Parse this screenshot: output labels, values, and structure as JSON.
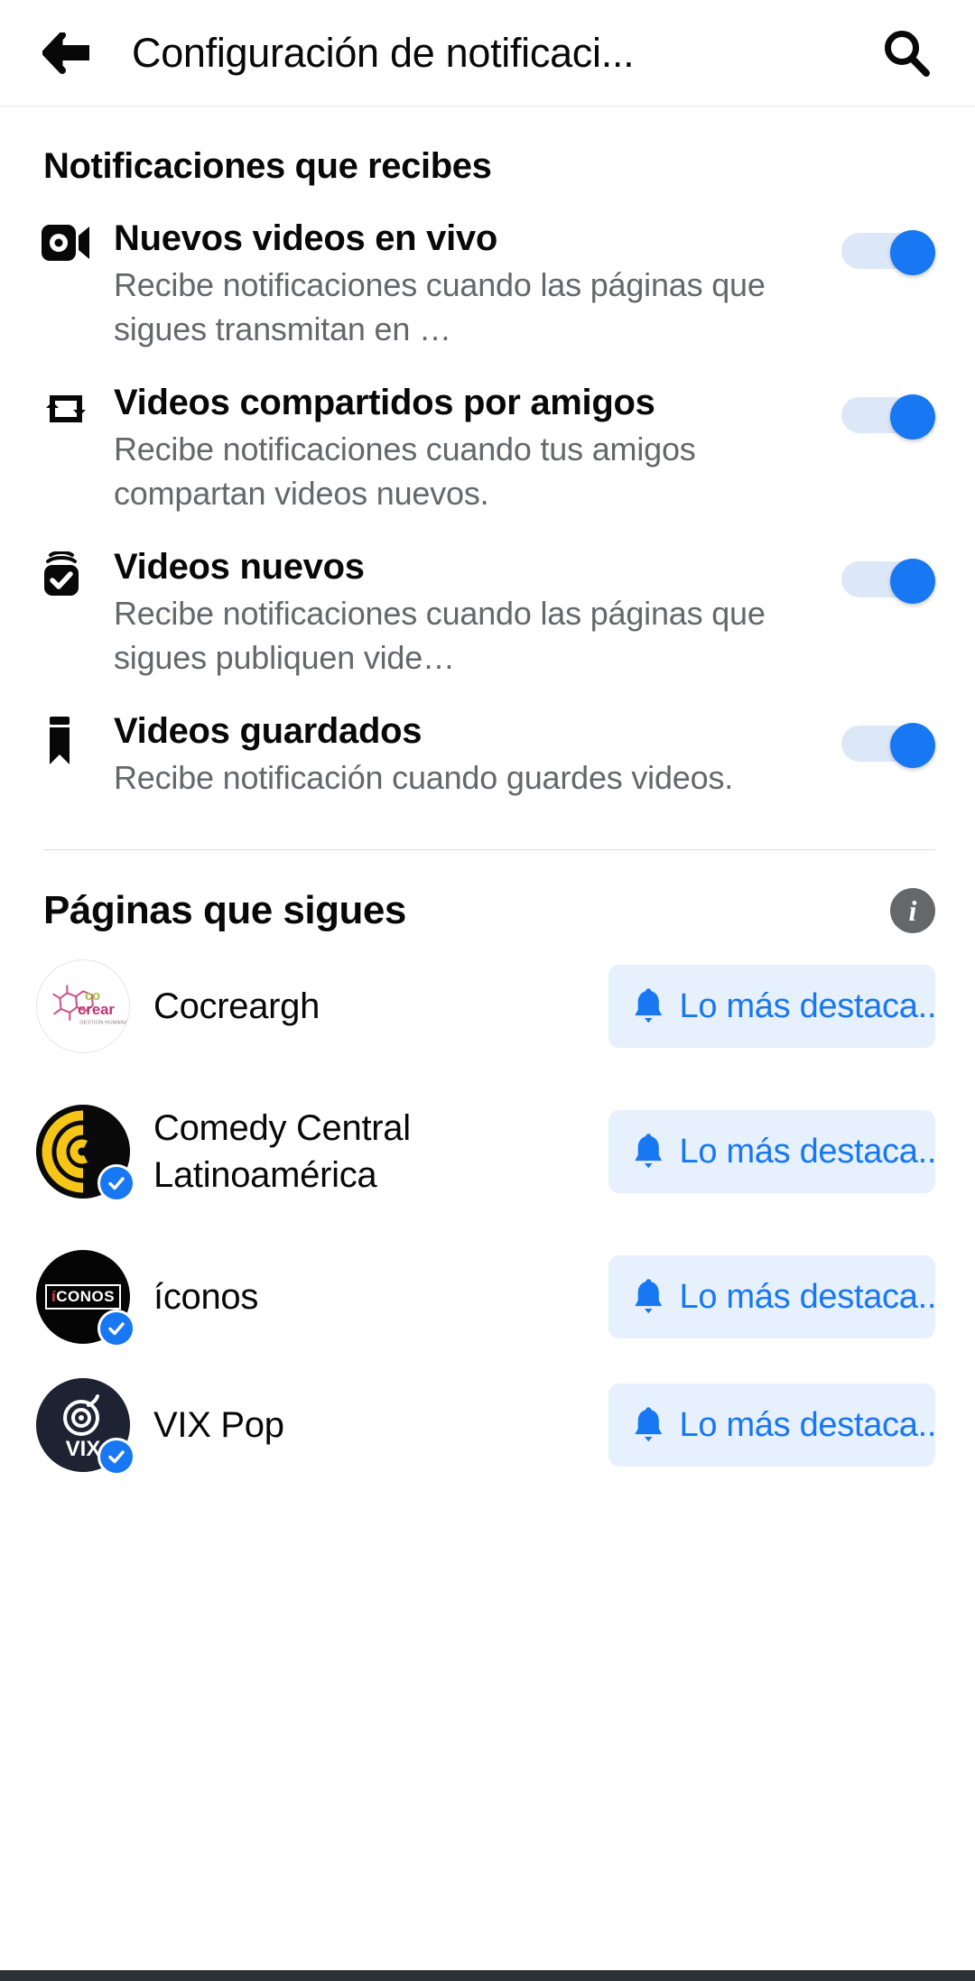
{
  "header": {
    "back_icon": "arrow-left-icon",
    "title": "Configuración de notificaci...",
    "search_icon": "search-icon"
  },
  "notifications_section": {
    "title": "Notificaciones que recibes",
    "items": [
      {
        "icon": "live-video-camera-icon",
        "title": "Nuevos videos en vivo",
        "description": "Recibe notificaciones cuando las páginas que sigues transmitan en …",
        "toggle_on": true
      },
      {
        "icon": "share-repeat-icon",
        "title": "Videos compartidos por amigos",
        "description": "Recibe notificaciones cuando tus amigos compartan videos nuevos.",
        "toggle_on": true
      },
      {
        "icon": "video-stack-check-icon",
        "title": "Videos nuevos",
        "description": "Recibe notificaciones cuando las páginas que sigues publiquen vide…",
        "toggle_on": true
      },
      {
        "icon": "bookmark-icon",
        "title": "Videos guardados",
        "description": "Recibe notificación cuando guardes videos.",
        "toggle_on": true
      }
    ]
  },
  "pages_section": {
    "title": "Páginas que sigues",
    "info_icon": "info-circle-icon",
    "info_glyph": "i",
    "pages": [
      {
        "name": "Cocreargh",
        "avatar_name": "cocrear-logo",
        "verified": false,
        "pill_icon": "bell-icon",
        "pill_label": "Lo más destaca..."
      },
      {
        "name": "Comedy Central Latinoamérica",
        "avatar_name": "comedy-central-logo",
        "verified": true,
        "pill_icon": "bell-icon",
        "pill_label": "Lo más destaca..."
      },
      {
        "name": "íconos",
        "avatar_name": "iconos-logo",
        "verified": true,
        "pill_icon": "bell-icon",
        "pill_label": "Lo más destaca..."
      },
      {
        "name": "VIX Pop",
        "avatar_name": "vix-pop-logo",
        "verified": true,
        "pill_icon": "bell-icon",
        "pill_label": "Lo más destaca..."
      }
    ]
  },
  "colors": {
    "accent_blue": "#1877f2",
    "pill_background": "#e7f0fd",
    "toggle_track": "#dce8f8",
    "secondary_text": "#65676b",
    "primary_text": "#080809",
    "divider": "#dcdee1"
  }
}
